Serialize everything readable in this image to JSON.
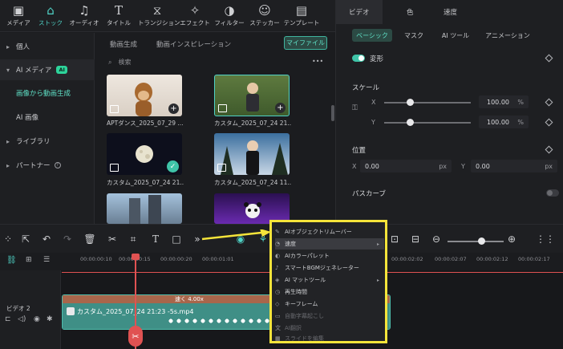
{
  "toolbar": {
    "items": [
      {
        "label": "メディア",
        "icon": "media-icon"
      },
      {
        "label": "ストック",
        "icon": "stock-icon"
      },
      {
        "label": "オーディオ",
        "icon": "audio-icon"
      },
      {
        "label": "タイトル",
        "icon": "title-icon"
      },
      {
        "label": "トランジション",
        "icon": "transition-icon"
      },
      {
        "label": "エフェクト",
        "icon": "effect-icon"
      },
      {
        "label": "フィルター",
        "icon": "filter-icon"
      },
      {
        "label": "ステッカー",
        "icon": "sticker-icon"
      },
      {
        "label": "テンプレート",
        "icon": "template-icon"
      }
    ],
    "active_index": 1
  },
  "leftnav": {
    "personal": "個人",
    "ai_media": "AI メディア",
    "ai_badge": "AI",
    "image_to_video": "画像から動画生成",
    "ai_image": "AI 画像",
    "library": "ライブラリ",
    "partner": "パートナー"
  },
  "media": {
    "tabs": [
      "動画生成",
      "動画インスピレーション"
    ],
    "my_files": "マイファイル",
    "search_placeholder": "検索",
    "more": "•••",
    "items": [
      {
        "caption": "APTダンス_2025_07_29 ..."
      },
      {
        "caption": "カスタム_2025_07_24 21..."
      },
      {
        "caption": "カスタム_2025_07_24 21..."
      },
      {
        "caption": "カスタム_2025_07_24 11..."
      }
    ]
  },
  "right": {
    "tabs": [
      "ビデオ",
      "色",
      "速度"
    ],
    "subtabs": [
      "ベーシック",
      "マスク",
      "AI ツール",
      "アニメーション"
    ],
    "transform": "変形",
    "scale": "スケール",
    "x_label": "X",
    "y_label": "Y",
    "scale_x": "100.00",
    "scale_y": "100.00",
    "percent": "%",
    "position": "位置",
    "pos_x": "0.00",
    "pos_y": "0.00",
    "px": "px",
    "path_curve": "パスカーブ",
    "scale_x_fraction": 0.3,
    "scale_y_fraction": 0.3
  },
  "timeline": {
    "ticks": [
      "00:00:00:10",
      "00:00:00:15",
      "00:00:00:20",
      "00:00:01:01",
      "00:00:02:02",
      "00:00:02:07",
      "00:00:02:12",
      "00:00:02:17"
    ],
    "track_name": "ビデオ 2",
    "speed_label": "速く 4.00x",
    "clip_name": "カスタム_2025_07_24 21:23 -5s.mp4"
  },
  "context_menu": {
    "items": [
      {
        "label": "AIオブジェクトリムーバー",
        "has_sub": false,
        "state": "normal"
      },
      {
        "label": "速度",
        "has_sub": true,
        "state": "hover"
      },
      {
        "label": "AIカラーパレット",
        "has_sub": false,
        "state": "normal"
      },
      {
        "label": "スマートBGMジェネレーター",
        "has_sub": false,
        "state": "normal"
      },
      {
        "label": "AI マットツール",
        "has_sub": true,
        "state": "normal"
      },
      {
        "label": "再生時間",
        "has_sub": false,
        "state": "normal"
      },
      {
        "label": "キーフレーム",
        "has_sub": false,
        "state": "normal"
      },
      {
        "label": "自動字幕起こし",
        "has_sub": false,
        "state": "disabled"
      },
      {
        "label": "AI翻訳",
        "has_sub": false,
        "state": "disabled"
      },
      {
        "label": "スライドを編集",
        "has_sub": false,
        "state": "disabled"
      }
    ]
  },
  "colors": {
    "accent": "#4fd1c5",
    "highlight_border": "#f5e43a",
    "playhead": "#e05252"
  }
}
